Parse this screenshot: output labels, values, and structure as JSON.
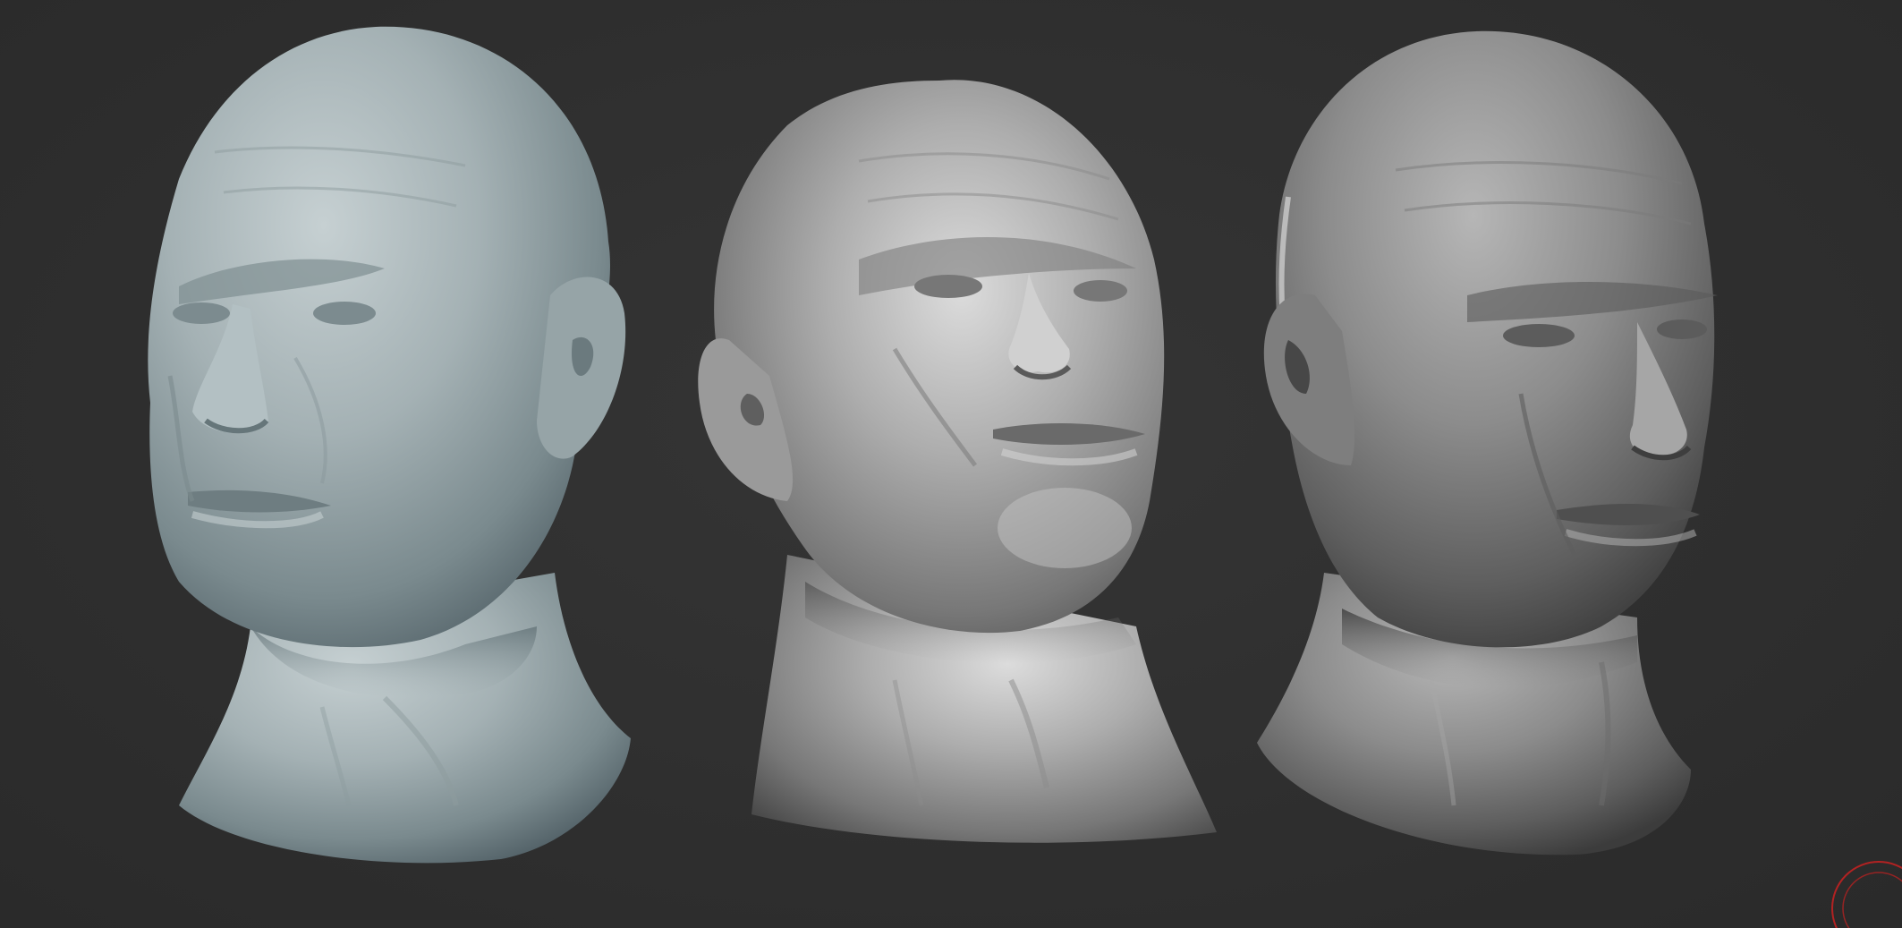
{
  "viewport": {
    "background": "#2e2e2e",
    "object_count": 3
  },
  "sculpts": [
    {
      "material": "matcap-blue-gray",
      "base_color": "#a9b6b9",
      "shade_color": "#58686c",
      "view": "three-quarter-left"
    },
    {
      "material": "matcap-silver",
      "base_color": "#b4b4b4",
      "shade_color": "#4a4a4a",
      "view": "three-quarter-upward"
    },
    {
      "material": "matcap-gray",
      "base_color": "#8e8e8e",
      "shade_color": "#3c3c3c",
      "view": "three-quarter-right"
    }
  ],
  "gizmo": {
    "icon": "rotate-gizmo-icon",
    "color": "#b22222"
  }
}
